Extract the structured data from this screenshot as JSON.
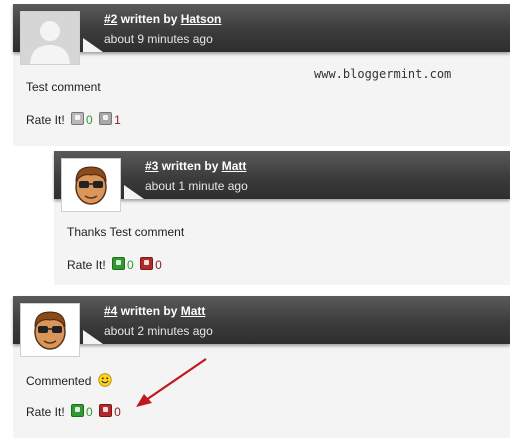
{
  "watermark": "www.bloggermint.com",
  "comments": [
    {
      "number": "#2",
      "written_by": "written by",
      "author": "Hatson",
      "time": "about 9 minutes ago",
      "text": "Test comment",
      "rate_label": "Rate It!",
      "up_count": "0",
      "down_count": "1",
      "avatar": "default-avatar-icon"
    },
    {
      "number": "#3",
      "written_by": "written by",
      "author": "Matt",
      "time": "about 1 minute ago",
      "text": "Thanks Test comment",
      "rate_label": "Rate It!",
      "up_count": "0",
      "down_count": "0",
      "avatar": "cartoon-avatar"
    },
    {
      "number": "#4",
      "written_by": "written by",
      "author": "Matt",
      "time": "about 2 minutes ago",
      "text": "Commented",
      "rate_label": "Rate It!",
      "up_count": "0",
      "down_count": "0",
      "avatar": "cartoon-avatar",
      "emoji": "smiley-icon"
    }
  ],
  "colors": {
    "header": "#3c3c3c",
    "up": "#2f9a2f",
    "down": "#8b1a1a",
    "arrow": "#c0181f"
  }
}
